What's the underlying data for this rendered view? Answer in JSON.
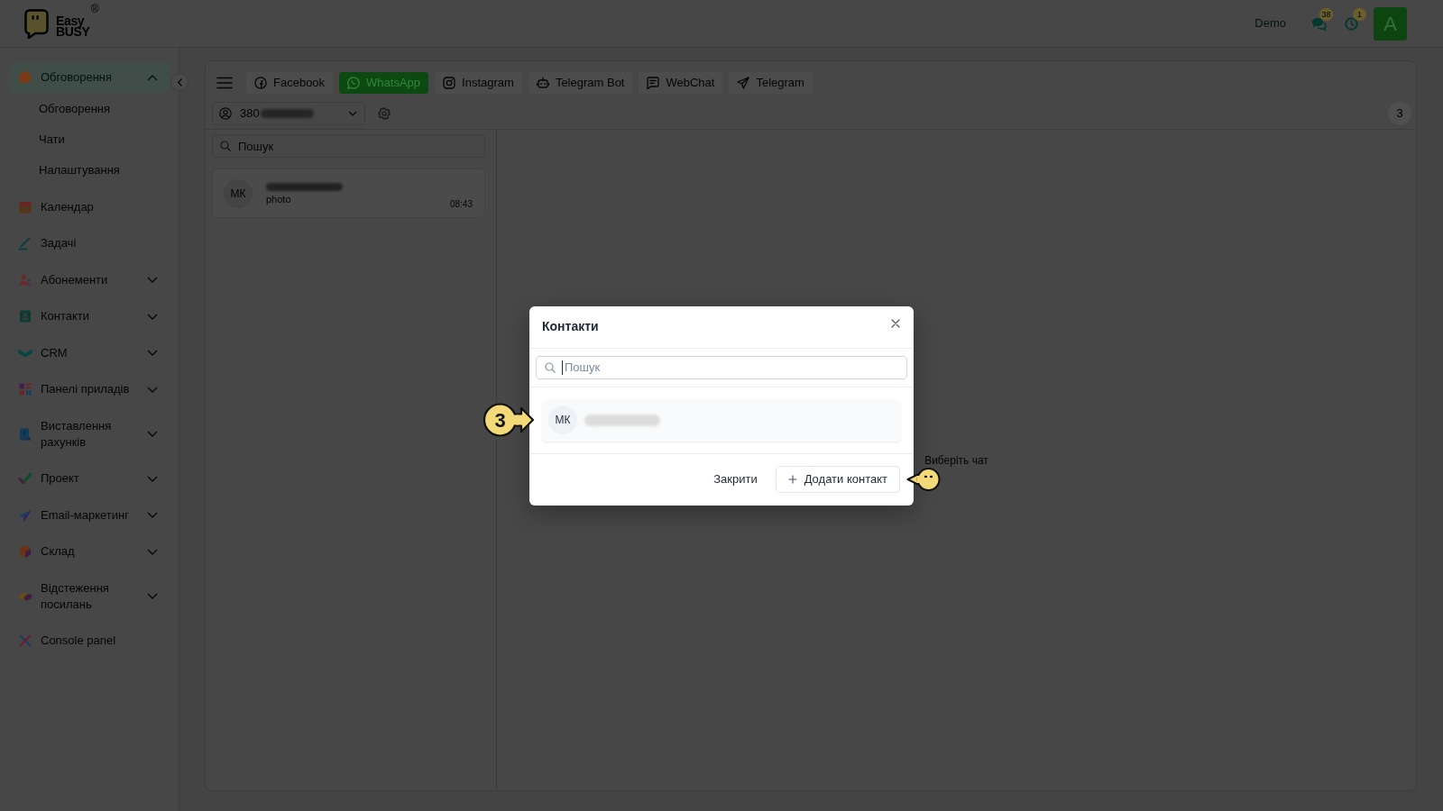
{
  "header": {
    "logo": {
      "lines": [
        "Easy",
        "BUSY"
      ],
      "mark": "®"
    },
    "user_name": "Demo",
    "notifications": [
      {
        "kind": "messages",
        "count": "38"
      },
      {
        "kind": "reminders",
        "count": "1"
      }
    ],
    "avatar": "A"
  },
  "sidebar": {
    "items": [
      {
        "kind": "group",
        "label": "Обговорення",
        "selected": true,
        "expanded": true,
        "children": [
          {
            "label": "Обговорення",
            "selected": false
          },
          {
            "label": "Чати",
            "selected": false
          },
          {
            "label": "Налаштування",
            "selected": false
          }
        ]
      },
      {
        "kind": "link",
        "label": "Календар",
        "selected": false
      },
      {
        "kind": "link",
        "label": "Задачі",
        "selected": false
      },
      {
        "kind": "group",
        "label": "Абонементи",
        "selected": false,
        "expanded": false
      },
      {
        "kind": "group",
        "label": "Контакти",
        "selected": false,
        "expanded": false
      },
      {
        "kind": "group",
        "label": "CRM",
        "selected": false,
        "expanded": false
      },
      {
        "kind": "group",
        "label": "Панелі приладів",
        "selected": false,
        "expanded": false
      },
      {
        "kind": "group",
        "label": "Виставлення рахунків",
        "selected": false,
        "expanded": false
      },
      {
        "kind": "group",
        "label": "Проект",
        "selected": false,
        "expanded": false
      },
      {
        "kind": "group",
        "label": "Email-маркетинг",
        "selected": false,
        "expanded": false
      },
      {
        "kind": "group",
        "label": "Склад",
        "selected": false,
        "expanded": false
      },
      {
        "kind": "group",
        "label": "Відстеження посилань",
        "selected": false,
        "expanded": false
      },
      {
        "kind": "link",
        "label": "Console panel",
        "selected": false
      }
    ]
  },
  "channel_tabs": [
    {
      "label": "Facebook",
      "selected": false
    },
    {
      "label": "WhatsApp",
      "selected": true
    },
    {
      "label": "Instagram",
      "selected": false
    },
    {
      "label": "Telegram Bot",
      "selected": false
    },
    {
      "label": "WebChat",
      "selected": false
    },
    {
      "label": "Telegram",
      "selected": false
    }
  ],
  "account_select": {
    "value": "380"
  },
  "unread_count": "3",
  "chat_list": {
    "search": {
      "placeholder": "Пошук"
    },
    "chats": [
      {
        "initials": "МК",
        "preview": "photo",
        "time": "08:43"
      }
    ]
  },
  "chat_view": {
    "empty_text": "Виберіть чат"
  },
  "dialog": {
    "title": "Контакти",
    "search": {
      "placeholder": "Пошук",
      "focused": true
    },
    "contacts": [
      {
        "initials": "МК"
      }
    ],
    "buttons": [
      {
        "kind": "text",
        "label": "Закрити"
      },
      {
        "kind": "outlined",
        "label": "Додати контакт"
      }
    ]
  },
  "tour_markers": [
    {
      "kind": "step",
      "label": "3"
    },
    {
      "kind": "face"
    }
  ]
}
